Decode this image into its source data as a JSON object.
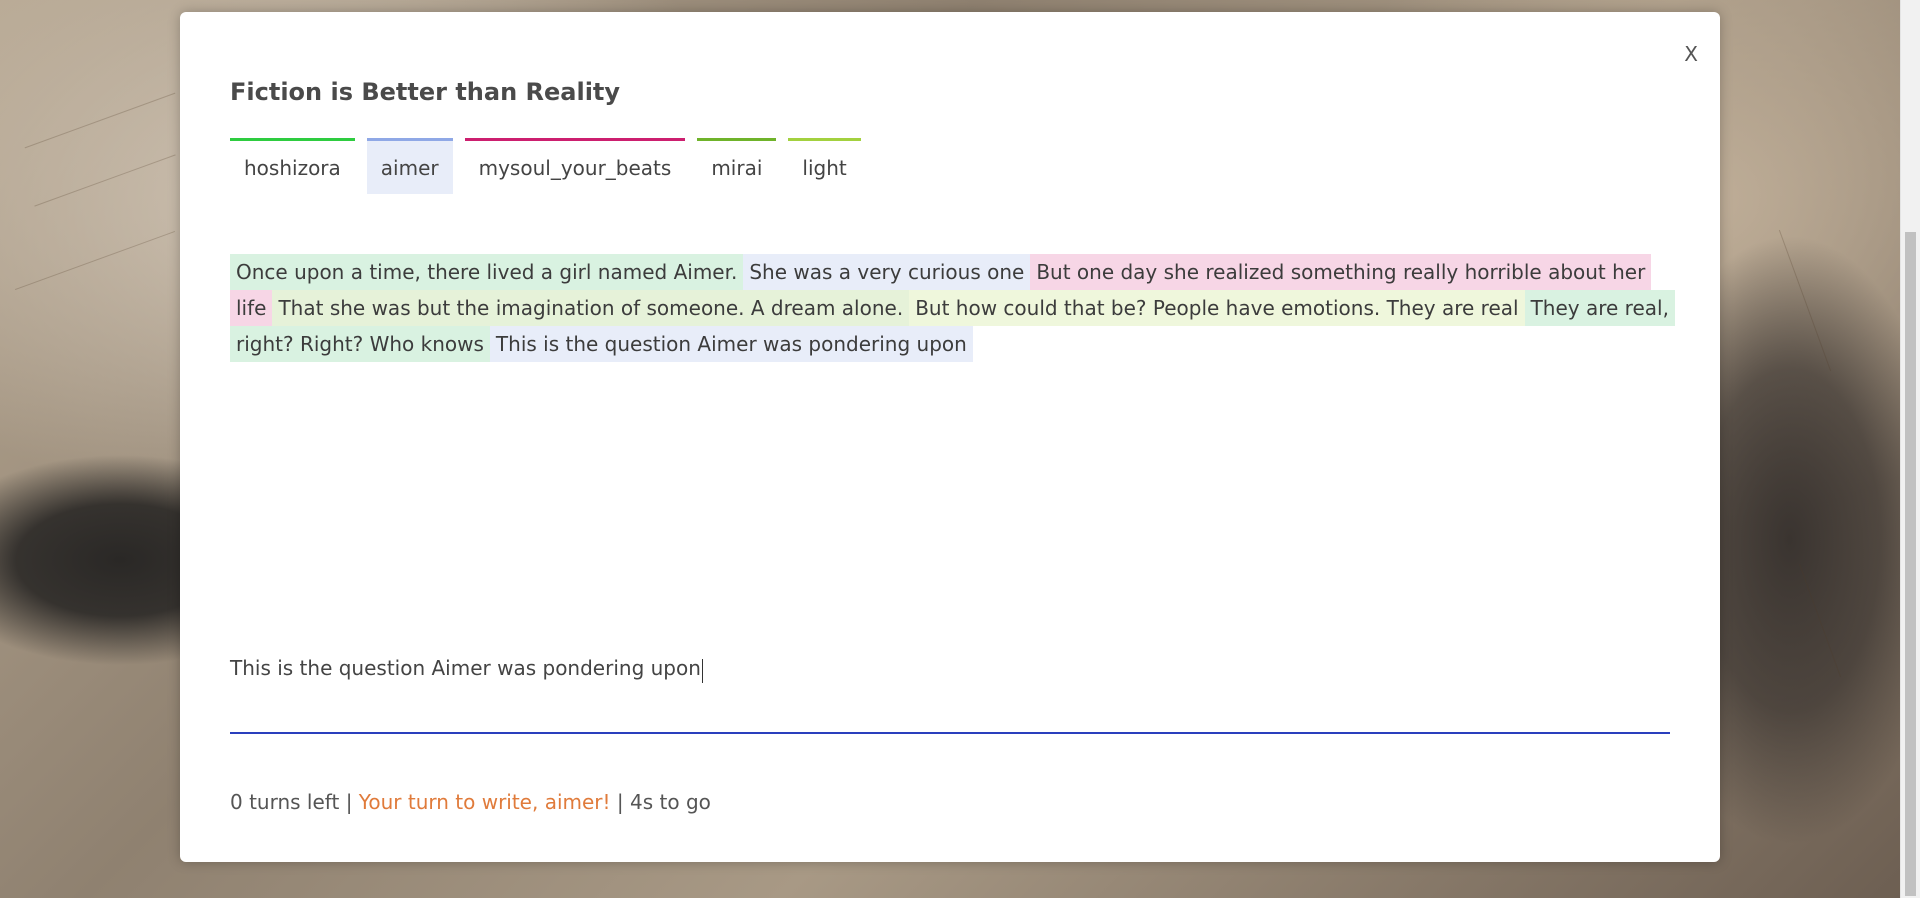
{
  "modal": {
    "title": "Fiction is Better than Reality",
    "close_label": "X"
  },
  "tabs": [
    {
      "label": "hoshizora",
      "color": "#2ecc40",
      "active": false
    },
    {
      "label": "aimer",
      "color": "#8fa8e6",
      "active": true
    },
    {
      "label": "mysoul_your_beats",
      "color": "#cc1f6f",
      "active": false
    },
    {
      "label": "mirai",
      "color": "#6fb32a",
      "active": false
    },
    {
      "label": "light",
      "color": "#a3d13f",
      "active": false
    }
  ],
  "story": {
    "segments": [
      {
        "text": "Once upon a time, there lived a girl named Aimer.",
        "author": "hoshizora",
        "bg": "#d9f2e1"
      },
      {
        "text": "She was a very curious one",
        "author": "aimer",
        "bg": "#e8edf9"
      },
      {
        "text": "But one day she realized something really horrible about her life",
        "author": "mysoul_your_beats",
        "bg": "#f7d6e6"
      },
      {
        "text": "That she was but the imagination of someone. A dream alone.",
        "author": "mirai",
        "bg": "#e6f2d9"
      },
      {
        "text": "But how could that be? People have emotions. They are real",
        "author": "light",
        "bg": "#eff7dc"
      },
      {
        "text": "They are real, right? Right? Who knows",
        "author": "hoshizora",
        "bg": "#d9f2e1"
      },
      {
        "text": "This is the question Aimer was pondering upon",
        "author": "aimer",
        "bg": "#e8edf9"
      }
    ]
  },
  "input": {
    "value": "This is the question Aimer was pondering upon"
  },
  "status": {
    "turns_left": "0 turns left",
    "separator": "|",
    "turn_message": "Your turn to write, aimer!",
    "timer": "4s to go"
  }
}
